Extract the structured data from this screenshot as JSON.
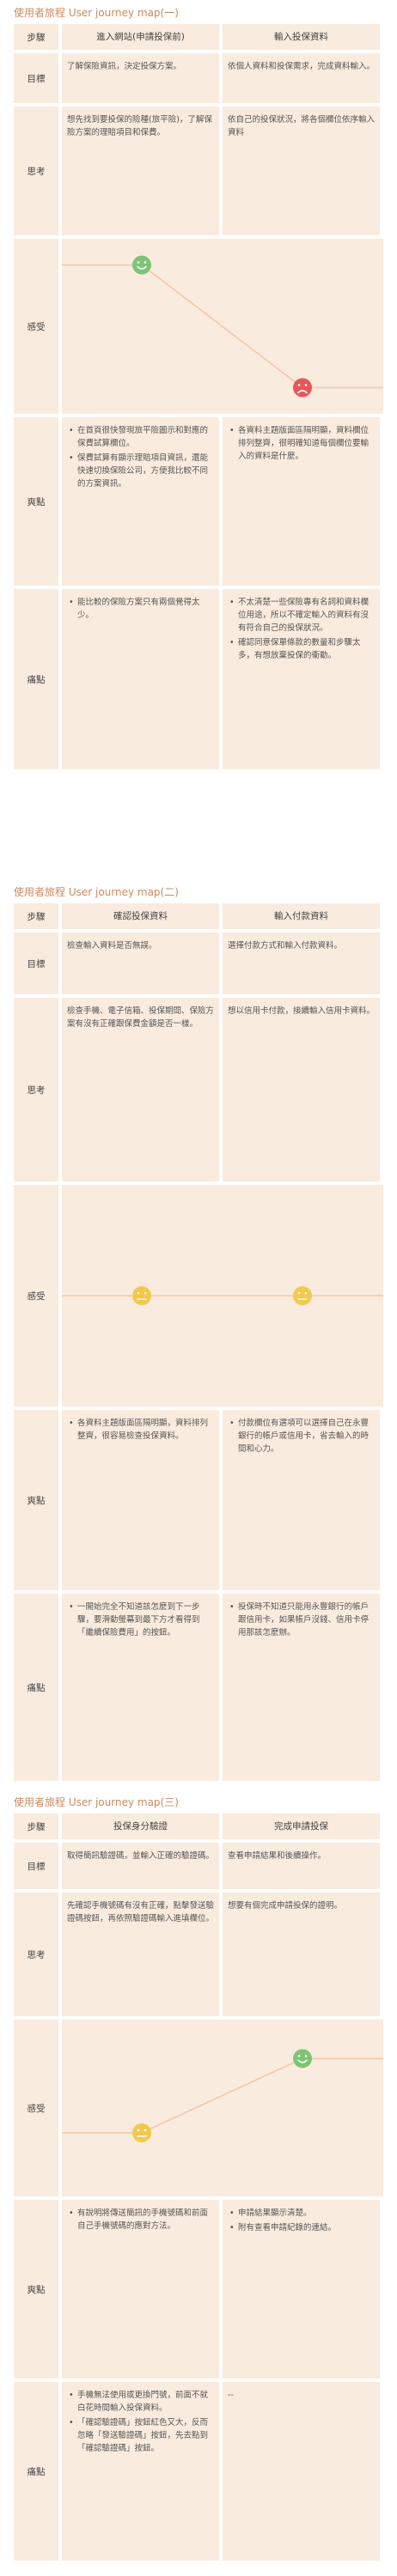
{
  "maps": [
    {
      "title": "使用者旅程 User journey map(一)",
      "labels": {
        "step": "步驟",
        "goal": "目標",
        "think": "思考",
        "feel": "感受",
        "pleasure": "爽點",
        "pain": "痛點"
      },
      "stages": [
        "進入網站(申請投保前)",
        "輸入投保資料"
      ],
      "goals": [
        "了解保險資訊，決定投保方案。",
        "依個人資料和投保需求，完成資料輸入。"
      ],
      "thinks": [
        "想先找到要投保的險種(旅平險)，了解保險方案的理賠項目和保費。",
        "依自己的投保狀況，將各個欄位依序輸入資料"
      ],
      "feel_levels": [
        1,
        0
      ],
      "feel_icons": [
        "happy-face",
        "sad-face"
      ],
      "pleasures": [
        [
          "在首頁很快發現旅平險圖示和對應的保費試算欄位。",
          "保費試算有顯示理賠項目資訊，還能快速切換保險公司，方便我比較不同的方案資訊。"
        ],
        [
          "各資料主題版面區隔明顯，資料欄位排列整齊，很明確知道每個欄位要輸入的資料是什麼。"
        ]
      ],
      "pains": [
        [
          "能比較的保險方案只有兩個覺得太少。"
        ],
        [
          "不太清楚一些保險專有名詞和資料欄位用途，所以不確定輸入的資料有沒有符合自己的投保狀況。",
          "確認同意保單條款的數量和步驟太多，有想放棄投保的衝動。"
        ]
      ]
    },
    {
      "title": "使用者旅程 User journey map(二)",
      "labels": {
        "step": "步驟",
        "goal": "目標",
        "think": "思考",
        "feel": "感受",
        "pleasure": "爽點",
        "pain": "痛點"
      },
      "stages": [
        "確認投保資料",
        "輸入付款資料"
      ],
      "goals": [
        "檢查輸入資料是否無誤。",
        "選擇付款方式和輸入付款資料。"
      ],
      "thinks": [
        "檢查手機、電子信箱、投保期間、保險方案有沒有正確跟保費金額是否一樣。",
        "想以信用卡付款，接續輸入信用卡資料。"
      ],
      "feel_levels": [
        0.5,
        0.5
      ],
      "feel_icons": [
        "neutral-face",
        "neutral-face"
      ],
      "pleasures": [
        [
          "各資料主題版面區隔明顯，資料排列整齊，很容易檢查投保資料。"
        ],
        [
          "付款欄位有選項可以選擇自己在永豐銀行的帳戶或信用卡，省去輸入的時間和心力。"
        ]
      ],
      "pains": [
        [
          "一開始完全不知道該怎麼到下一步驟，要滑動螢幕到最下方才看得到「繼續保險費用」的按鈕。"
        ],
        [
          "投保時不知道只能用永豐銀行的帳戶跟信用卡，如果帳戶沒錢、信用卡停用那該怎麼辦。"
        ]
      ]
    },
    {
      "title": "使用者旅程 User journey map(三)",
      "labels": {
        "step": "步驟",
        "goal": "目標",
        "think": "思考",
        "feel": "感受",
        "pleasure": "爽點",
        "pain": "痛點"
      },
      "stages": [
        "投保身分驗證",
        "完成申請投保"
      ],
      "goals": [
        "取得簡訊驗證碼，並輸入正確的驗證碼。",
        "查看申請結果和後續操作。"
      ],
      "thinks": [
        "先確認手機號碼有沒有正確，點擊發送驗證碼按鈕，再依照驗證碼輸入進填欄位。",
        "想要有個完成申請投保的證明。"
      ],
      "feel_levels": [
        0.3,
        0.9
      ],
      "feel_icons": [
        "neutral-face",
        "happy-face"
      ],
      "pleasures": [
        [
          "有說明將傳送簡訊的手機號碼和前面自己手機號碼的應對方法。"
        ],
        [
          "申請結果顯示清楚。",
          "附有查看申請紀錄的連結。"
        ]
      ],
      "pains": [
        [
          "手機無法使用或更換門號，前面不就白花時間輸入投保資料。",
          "「確認驗證碼」按鈕紅色又大，反而忽略「發送驗證碼」按鈕，先去點到「確認驗證碼」按鈕。"
        ],
        [
          "--"
        ]
      ]
    }
  ],
  "colors": {
    "cell_bg": "#f9ebde",
    "title": "#c98a5e",
    "line": "#f2c7a7",
    "happy": "#7cc576",
    "sad": "#e8565a",
    "neutral": "#f3c84d"
  }
}
